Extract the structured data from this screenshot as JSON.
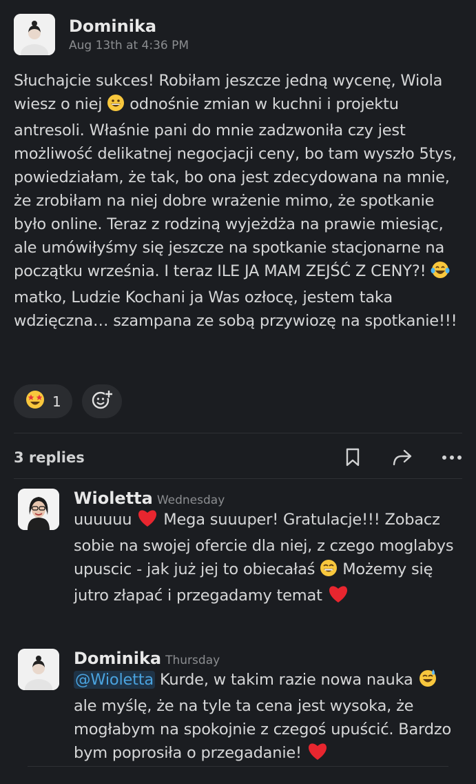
{
  "post": {
    "author": "Dominika",
    "time": "Aug 13th at 4:36 PM",
    "text_1": "Słuchajcie sukces! Robiłam jeszcze jedną wycenę, Wiola wiesz o niej",
    "emoji_1": "grinning-face",
    "text_2": "odnośnie zmian w kuchni i projektu antresoli. Właśnie pani do mnie zadzwoniła czy jest możliwość delikatnej negocjacji ceny, bo tam wyszło 5tys, powiedziałam, że tak, bo ona jest zdecydowana na mnie, że zrobiłam na niej dobre wrażenie mimo, że spotkanie było online. Teraz z rodziną wyjeżdża na prawie miesiąc, ale umówiłyśmy się jeszcze na spotkanie stacjonarne na początku września. I teraz ILE JA MAM ZEJŚĆ Z CENY?!",
    "emoji_2": "face-with-tears-of-joy",
    "text_3": "matko, Ludzie Kochani ja Was ozłocę, jestem taka wdzięczna… szampana ze sobą przywiozę na spotkanie!!!"
  },
  "reactions": [
    {
      "emoji": "star-struck",
      "count": "1"
    },
    {
      "emoji": "add-reaction-icon"
    }
  ],
  "replies_bar": {
    "label": "3 replies",
    "icons": [
      "bookmark-icon",
      "share-icon",
      "more-icon"
    ]
  },
  "replies": [
    {
      "author": "Wioletta",
      "time": "Wednesday",
      "text_1": "uuuuuu",
      "emoji_1": "red-heart",
      "text_2": "Mega suuuper! Gratulacje!!! Zobacz sobie na swojej ofercie dla niej, z czego moglabys upuscic - jak już jej to obiecałaś",
      "emoji_2": "grinning-face-with-smiling-eyes",
      "text_3": "Możemy się jutro złapać i przegadamy temat",
      "emoji_3": "red-heart"
    },
    {
      "author": "Dominika",
      "time": "Thursday",
      "mention": "@Wioletta",
      "text_1": "Kurde, w takim razie nowa nauka",
      "emoji_1": "grinning-face-with-sweat",
      "text_2": "ale myślę, że na tyle ta cena jest wysoka, że mogłabym na spokojnie z czegoś upuścić. Bardzo bym poprosiła o przegadanie!",
      "emoji_2": "red-heart"
    }
  ]
}
